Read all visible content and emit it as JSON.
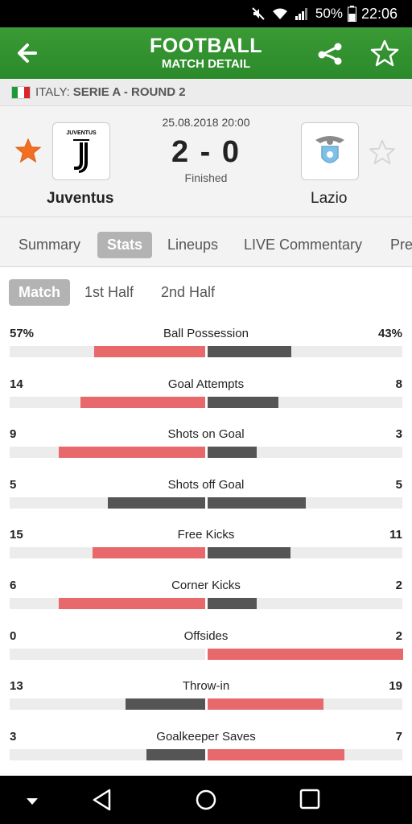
{
  "status_bar": {
    "battery": "50%",
    "time": "22:06"
  },
  "header": {
    "title": "FOOTBALL",
    "subtitle": "MATCH DETAIL"
  },
  "league": {
    "country": "ITALY:",
    "competition": "SERIE A - ROUND 2"
  },
  "match": {
    "datetime": "25.08.2018 20:00",
    "score": "2 - 0",
    "status": "Finished",
    "home_team": "Juventus",
    "away_team": "Lazio",
    "home_logo_text": "JUVENTUS"
  },
  "tabs": [
    "Summary",
    "Stats",
    "Lineups",
    "LIVE Commentary",
    "Pre"
  ],
  "subtabs": [
    "Match",
    "1st Half",
    "2nd Half"
  ],
  "colors": {
    "green": "#2e8b2e",
    "winner_bar": "#e8696b",
    "loser_bar": "#555555",
    "star_orange": "#f26f21"
  },
  "stats": [
    {
      "label": "Ball Possession",
      "home": "57%",
      "away": "43%",
      "home_n": 57,
      "away_n": 43
    },
    {
      "label": "Goal Attempts",
      "home": "14",
      "away": "8",
      "home_n": 14,
      "away_n": 8
    },
    {
      "label": "Shots on Goal",
      "home": "9",
      "away": "3",
      "home_n": 9,
      "away_n": 3
    },
    {
      "label": "Shots off Goal",
      "home": "5",
      "away": "5",
      "home_n": 5,
      "away_n": 5
    },
    {
      "label": "Free Kicks",
      "home": "15",
      "away": "11",
      "home_n": 15,
      "away_n": 11
    },
    {
      "label": "Corner Kicks",
      "home": "6",
      "away": "2",
      "home_n": 6,
      "away_n": 2
    },
    {
      "label": "Offsides",
      "home": "0",
      "away": "2",
      "home_n": 0,
      "away_n": 2
    },
    {
      "label": "Throw-in",
      "home": "13",
      "away": "19",
      "home_n": 13,
      "away_n": 19
    },
    {
      "label": "Goalkeeper Saves",
      "home": "3",
      "away": "7",
      "home_n": 3,
      "away_n": 7
    }
  ]
}
